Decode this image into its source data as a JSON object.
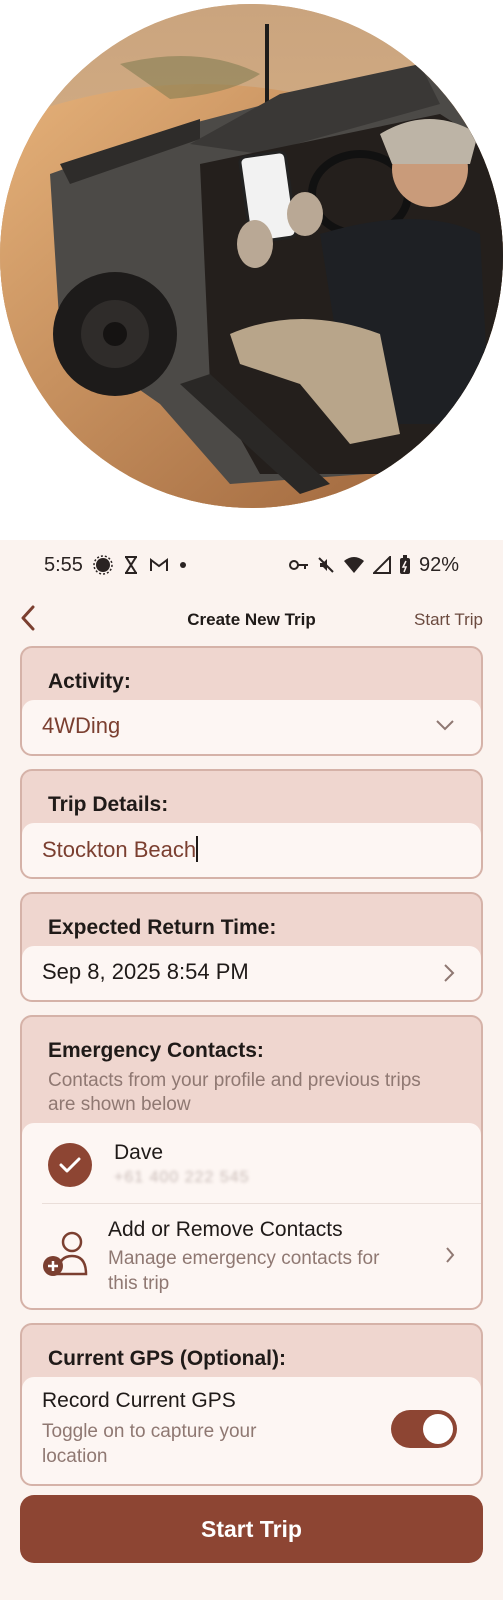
{
  "status_bar": {
    "time": "5:55",
    "battery": "92%"
  },
  "nav": {
    "title": "Create New Trip",
    "action": "Start Trip"
  },
  "activity": {
    "label": "Activity:",
    "value": "4WDing"
  },
  "trip_details": {
    "label": "Trip Details:",
    "value": "Stockton Beach"
  },
  "return_time": {
    "label": "Expected Return Time:",
    "value": "Sep 8, 2025 8:54 PM"
  },
  "emergency": {
    "label": "Emergency Contacts:",
    "subtitle": "Contacts from your profile and previous trips are shown below",
    "contacts": [
      {
        "name": "Dave",
        "phone": "+61 400 222 545",
        "selected": true
      }
    ],
    "manage": {
      "title": "Add or Remove Contacts",
      "subtitle": "Manage emergency contacts for this trip"
    }
  },
  "gps": {
    "label": "Current GPS (Optional):",
    "title": "Record Current GPS",
    "subtitle": "Toggle on to capture your location",
    "enabled": true
  },
  "primary_button": "Start Trip",
  "colors": {
    "accent": "#8d4533",
    "card_header": "#efd6cf",
    "background": "#fbf3ef",
    "field_text": "#7b3f30"
  }
}
